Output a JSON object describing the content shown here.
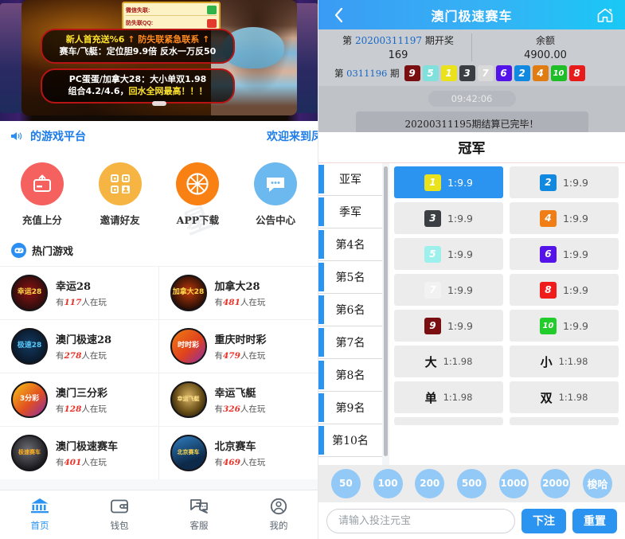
{
  "left": {
    "carousel": {
      "qq_box": {
        "row1": "微信失联:",
        "row2": "防失联QQ:"
      },
      "banner1_line1_a": "新人首充送%6",
      "banner1_line1_b": "↑ 防失联紧急联系 ↑",
      "banner1_line2": "赛车/飞艇：定位胆9.9倍 反水一万反50",
      "banner2_line1": "PC蛋蛋/加拿大28：大小单双1.98",
      "banner2_line2_a": "组合4.2/4.6，",
      "banner2_line2_b": "回水全网最高！！！"
    },
    "notice": {
      "icon": "speaker-icon",
      "left_text": "的游戏平台",
      "right_text": "欢迎来到凤"
    },
    "quick_nav": [
      {
        "label": "充值上分",
        "icon": "deposit-card-icon",
        "color": "#f4615f"
      },
      {
        "label": "邀请好友",
        "icon": "qrcode-invite-icon",
        "color": "#f6b442"
      },
      {
        "label": "APP下载",
        "icon": "orange-slice-icon",
        "color": "#f98013"
      },
      {
        "label": "公告中心",
        "icon": "announcement-chat-icon",
        "color": "#6cb9f0"
      }
    ],
    "hot_section": {
      "icon": "gamepad-icon",
      "title": "热门游戏"
    },
    "games": [
      {
        "name": "幸运28",
        "players_prefix": "有",
        "players": "117",
        "players_suffix": "人在玩",
        "badge": "幸运28",
        "c1": "#2a0d0d",
        "c2": "#8e1212"
      },
      {
        "name": "加拿大28",
        "players_prefix": "有",
        "players": "481",
        "players_suffix": "人在玩",
        "badge": "加拿大28",
        "c1": "#1a0b06",
        "c2": "#c0390a"
      },
      {
        "name": "澳门极速28",
        "players_prefix": "有",
        "players": "278",
        "players_suffix": "人在玩",
        "badge": "极速28",
        "c1": "#0a1624",
        "c2": "#123a63"
      },
      {
        "name": "重庆时时彩",
        "players_prefix": "有",
        "players": "479",
        "players_suffix": "人在玩",
        "badge": "时时彩",
        "c1": "#f07d12",
        "c2": "#8c2ea8"
      },
      {
        "name": "澳门三分彩",
        "players_prefix": "有",
        "players": "128",
        "players_suffix": "人在玩",
        "badge": "3分彩",
        "c1": "#f5c518",
        "c2": "#d2202a"
      },
      {
        "name": "幸运飞艇",
        "players_prefix": "有",
        "players": "326",
        "players_suffix": "人在玩",
        "badge": "幸运飞艇",
        "c1": "#2b1c08",
        "c2": "#c09a44"
      },
      {
        "name": "澳门极速赛车",
        "players_prefix": "有",
        "players": "401",
        "players_suffix": "人在玩",
        "badge": "极速赛车",
        "c1": "#101014",
        "c2": "#5a5a62"
      },
      {
        "name": "北京赛车",
        "players_prefix": "有",
        "players": "469",
        "players_suffix": "人在玩",
        "badge": "北京赛车",
        "c1": "#0d2a4a",
        "c2": "#2f7ec0"
      }
    ],
    "tabbar": [
      {
        "label": "首页",
        "icon": "home-bank-icon",
        "active": true
      },
      {
        "label": "钱包",
        "icon": "wallet-icon",
        "active": false
      },
      {
        "label": "客服",
        "icon": "support-chat-icon",
        "active": false
      },
      {
        "label": "我的",
        "icon": "user-profile-icon",
        "active": false
      }
    ]
  },
  "right": {
    "header": {
      "back_icon": "chevron-left-icon",
      "title": "澳门极速赛车",
      "home_icon": "home-icon"
    },
    "info": {
      "draw_prefix": "第",
      "draw_issue": "20200311197",
      "draw_suffix": "期开奖",
      "countdown": "169",
      "balance_label": "余额",
      "balance_value": "4900.00",
      "last_prefix": "第",
      "last_issue": "0311196",
      "last_suffix": "期",
      "last_balls": [
        {
          "n": "9",
          "bg": "#7a0f12",
          "fg": "#ffffff"
        },
        {
          "n": "5",
          "bg": "#7fe0dc",
          "fg": "#ffffff"
        },
        {
          "n": "1",
          "bg": "#e9e21c",
          "fg": "#ffffff"
        },
        {
          "n": "3",
          "bg": "#3b3f44",
          "fg": "#ffffff"
        },
        {
          "n": "7",
          "bg": "#d9d9d9",
          "fg": "#ffffff"
        },
        {
          "n": "6",
          "bg": "#5413e8",
          "fg": "#ffffff"
        },
        {
          "n": "2",
          "bg": "#1189e0",
          "fg": "#ffffff"
        },
        {
          "n": "4",
          "bg": "#e07c12",
          "fg": "#ffffff"
        },
        {
          "n": "10",
          "bg": "#1fbd27",
          "fg": "#ffffff"
        },
        {
          "n": "8",
          "bg": "#e81b1b",
          "fg": "#ffffff"
        }
      ]
    },
    "chat": {
      "time": "09:42:06",
      "message": "20200311195期结算已完毕！"
    },
    "game": {
      "title": "冠军",
      "positions": [
        "亚军",
        "季军",
        "第4名",
        "第5名",
        "第6名",
        "第7名",
        "第8名",
        "第9名",
        "第10名"
      ],
      "bets": [
        {
          "ball": "1",
          "bg": "#e9e21c",
          "odds": "1:9.9",
          "selected": true
        },
        {
          "ball": "2",
          "bg": "#1189e0",
          "odds": "1:9.9",
          "selected": false
        },
        {
          "ball": "3",
          "bg": "#3b3f44",
          "odds": "1:9.9",
          "selected": false
        },
        {
          "ball": "4",
          "bg": "#f07d16",
          "odds": "1:9.9",
          "selected": false
        },
        {
          "ball": "5",
          "bg": "#9ef0ec",
          "odds": "1:9.9",
          "selected": false
        },
        {
          "ball": "6",
          "bg": "#5413e8",
          "odds": "1:9.9",
          "selected": false
        },
        {
          "ball": "7",
          "bg": "#f2f2f2",
          "odds": "1:9.9",
          "selected": false
        },
        {
          "ball": "8",
          "bg": "#f01b1b",
          "odds": "1:9.9",
          "selected": false
        },
        {
          "ball": "9",
          "bg": "#7a0f12",
          "odds": "1:9.9",
          "selected": false
        },
        {
          "ball": "10",
          "bg": "#22cc2a",
          "odds": "1:9.9",
          "selected": false
        }
      ],
      "side_bets": [
        {
          "word": "大",
          "odds": "1:1.98"
        },
        {
          "word": "小",
          "odds": "1:1.98"
        },
        {
          "word": "单",
          "odds": "1:1.98"
        },
        {
          "word": "双",
          "odds": "1:1.98"
        }
      ]
    },
    "chips": [
      "50",
      "100",
      "200",
      "500",
      "1000",
      "2000",
      "梭哈"
    ],
    "bet_bar": {
      "input_value": "",
      "input_placeholder": "请输入投注元宝",
      "submit_label": "下注",
      "reset_label": "重置"
    }
  },
  "colors": {
    "accent": "#2b93f0",
    "header_from": "#3a9bf4",
    "header_to": "#19c8f5",
    "chip": "#92c9f7"
  }
}
